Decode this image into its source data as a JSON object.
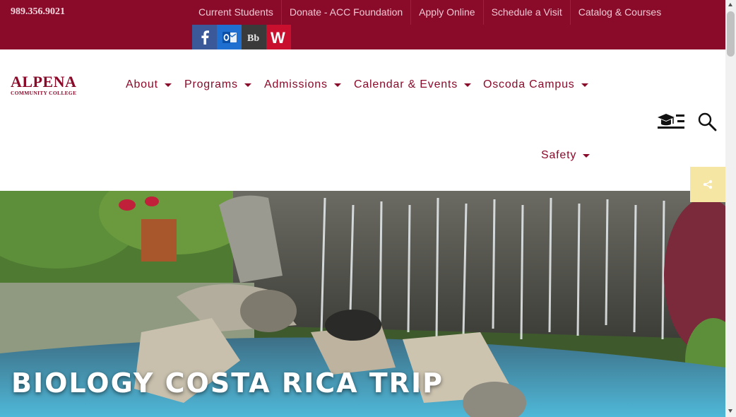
{
  "topbar": {
    "phone": "989.356.9021",
    "links": [
      "Current Students",
      "Donate - ACC Foundation",
      "Apply Online",
      "Schedule a Visit",
      "Catalog & Courses"
    ],
    "social": [
      {
        "icon": "facebook-icon",
        "glyph": "f",
        "bg": "#3b5998"
      },
      {
        "icon": "outlook-icon",
        "glyph": "O",
        "bg": "#1f6fd1"
      },
      {
        "icon": "blackboard-icon",
        "glyph": "Bb",
        "bg": "#3a3a3a"
      },
      {
        "icon": "webadvisor-icon",
        "glyph": "W",
        "bg": "#c8102e"
      }
    ]
  },
  "logo": {
    "name": "ALPENA",
    "sub": "COMMUNITY COLLEGE"
  },
  "nav": {
    "about": "About",
    "programs": "Programs",
    "admissions": "Admissions",
    "calendar": "Calendar & Events",
    "oscoda": "Oscoda Campus",
    "safety": "Safety"
  },
  "hero": {
    "title": "BIOLOGY COSTA RICA TRIP"
  },
  "colors": {
    "brand": "#8a0a2a",
    "share_bg": "#f5e6a3"
  }
}
